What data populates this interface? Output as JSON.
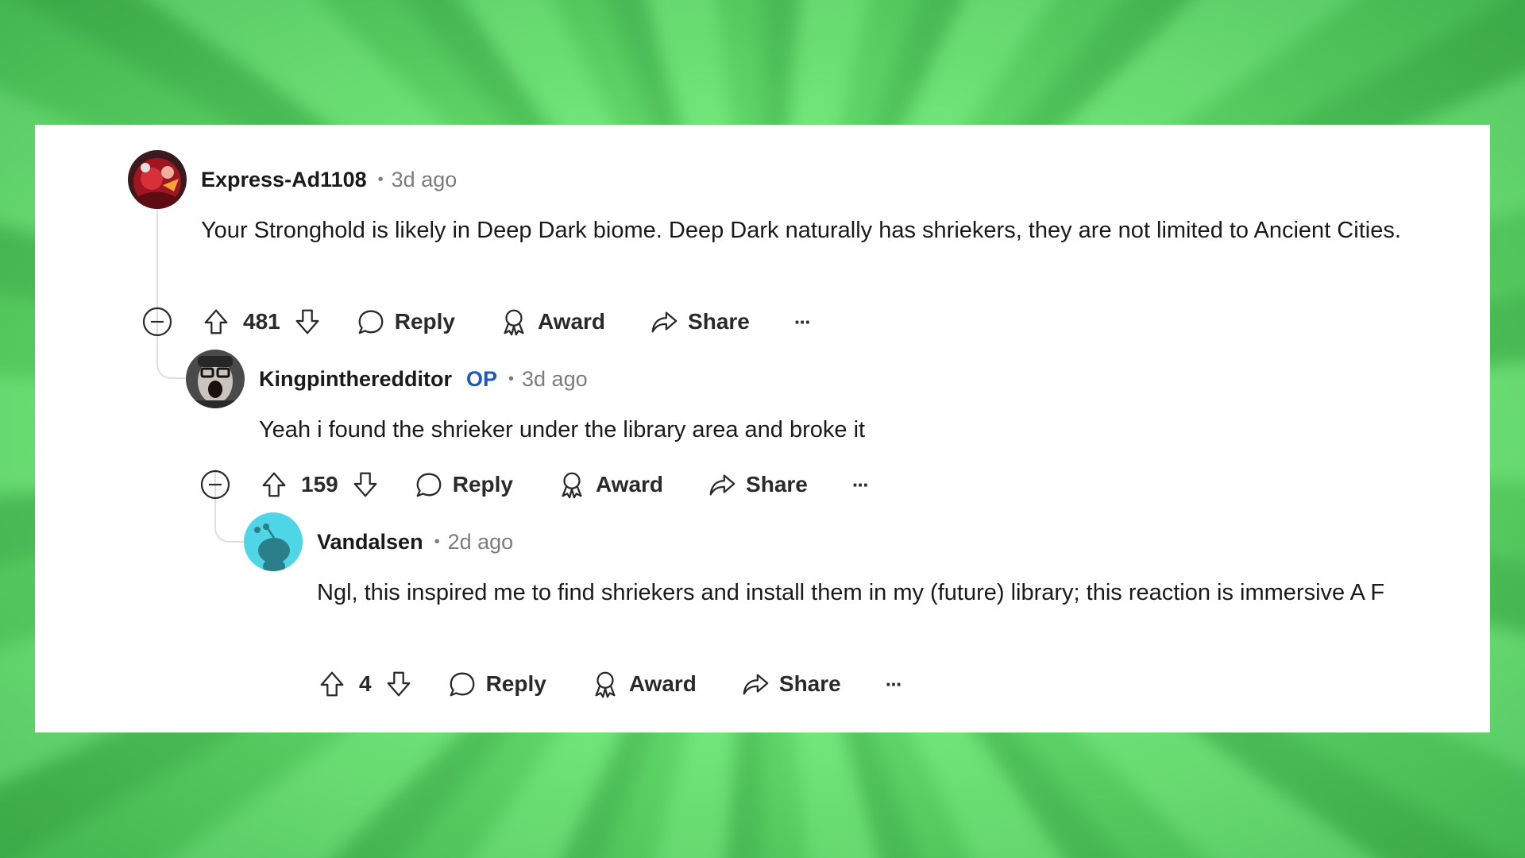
{
  "comments": [
    {
      "username": "Express-Ad1108",
      "is_op": false,
      "time": "3d ago",
      "text": "Your Stronghold is likely in Deep Dark biome. Deep Dark naturally has shriekers, they are not limited to Ancient Cities.",
      "votes": "481",
      "avatar_icon": "red-character-avatar"
    },
    {
      "username": "Kingpintheredditor",
      "is_op": true,
      "op_label": "OP",
      "time": "3d ago",
      "text": "Yeah i found the shrieker under the library area and broke it",
      "votes": "159",
      "avatar_icon": "screaming-man-avatar"
    },
    {
      "username": "Vandalsen",
      "is_op": false,
      "time": "2d ago",
      "text": "Ngl, this inspired me to find shriekers and install them in my (future) library; this reaction is immersive A F",
      "votes": "4",
      "avatar_icon": "default-snoo-avatar"
    }
  ],
  "actions": {
    "reply": "Reply",
    "award": "Award",
    "share": "Share",
    "more": "···"
  },
  "colors": {
    "op_blue": "#1e5ab9",
    "muted": "#7c7c7c",
    "text": "#1a1a1b",
    "background_green": "#6fe27a"
  },
  "separator": "•"
}
